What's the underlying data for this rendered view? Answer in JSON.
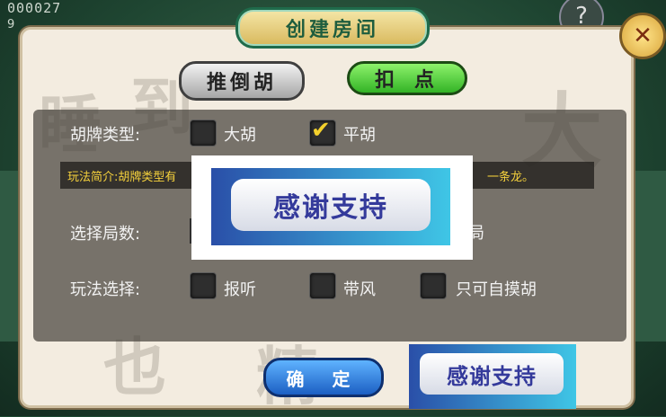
{
  "header": {
    "room_id": "000027",
    "room_sub": "9"
  },
  "title": "创建房间",
  "tabs": [
    {
      "label": "推倒胡",
      "active": false
    },
    {
      "label": "扣点",
      "active": true
    }
  ],
  "hu_type": {
    "label": "胡牌类型:",
    "options": [
      {
        "label": "大胡",
        "checked": false
      },
      {
        "label": "平胡",
        "checked": true
      }
    ]
  },
  "intro": {
    "left": "玩法简介:胡牌类型有",
    "right": "一条龙。"
  },
  "rounds": {
    "label": "选择局数:",
    "suffix": "局"
  },
  "play": {
    "label": "玩法选择:",
    "options": [
      {
        "label": "报听",
        "checked": false
      },
      {
        "label": "带风",
        "checked": false
      },
      {
        "label": "只可自摸胡",
        "checked": false
      }
    ]
  },
  "confirm_label": "确 定",
  "overlay_text": "感谢支持",
  "colors": {
    "accent_green": "#33b326",
    "panel": "#f3ece0",
    "check": "#f3d02c"
  }
}
